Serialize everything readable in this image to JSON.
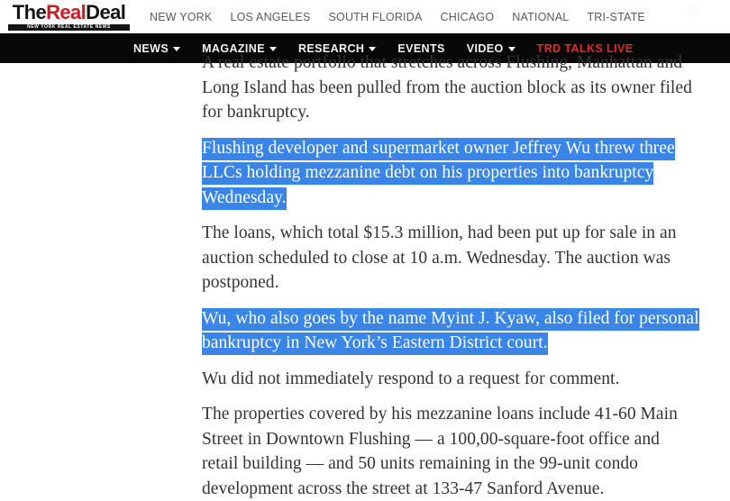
{
  "site": {
    "logo": {
      "part1": "The",
      "part2": "Real",
      "part3": "Deal",
      "tagline": "NEW YORK REAL ESTATE NEWS"
    },
    "brand_colors": {
      "red": "#cf181f",
      "black": "#141414",
      "nav_bar": "#080808",
      "selection_blue": "#3a86e8"
    },
    "top_nav": [
      {
        "label": "NEW YORK"
      },
      {
        "label": "LOS ANGELES"
      },
      {
        "label": "SOUTH FLORIDA"
      },
      {
        "label": "CHICAGO"
      },
      {
        "label": "NATIONAL"
      },
      {
        "label": "TRI-STATE"
      }
    ],
    "search_icon": "search-icon",
    "main_nav": [
      {
        "label": "NEWS",
        "has_dropdown": true,
        "accent": false
      },
      {
        "label": "MAGAZINE",
        "has_dropdown": true,
        "accent": false
      },
      {
        "label": "RESEARCH",
        "has_dropdown": true,
        "accent": false
      },
      {
        "label": "EVENTS",
        "has_dropdown": false,
        "accent": false
      },
      {
        "label": "VIDEO",
        "has_dropdown": true,
        "accent": false
      },
      {
        "label": "TRD TALKS LIVE",
        "has_dropdown": false,
        "accent": true
      }
    ]
  },
  "article": {
    "paragraphs": [
      {
        "clipped": true,
        "segments": [
          {
            "text": "A real estate portfolio that stretches across Flushing, Manhattan and Long Island has been pulled from the auction block as its owner filed for bankruptcy.",
            "highlighted": false
          }
        ]
      },
      {
        "clipped": false,
        "segments": [
          {
            "text": "Flushing developer and supermarket owner Jeffrey Wu threw three LLCs holding mezzanine debt on his properties into bankruptcy Wednesday.",
            "highlighted": true
          }
        ]
      },
      {
        "clipped": false,
        "segments": [
          {
            "text": "The loans, which total $15.3 million, had been put up for sale in an auction scheduled to close at 10 a.m. Wednesday. The auction was postponed.",
            "highlighted": false
          }
        ]
      },
      {
        "clipped": false,
        "segments": [
          {
            "text": " Wu, who also goes by the name Myint J. Kyaw, also filed for personal bankruptcy in New York’s Eastern District court.",
            "highlighted": true
          }
        ]
      },
      {
        "clipped": false,
        "segments": [
          {
            "text": "Wu did not immediately respond to a request for comment.",
            "highlighted": false
          }
        ]
      },
      {
        "clipped": false,
        "segments": [
          {
            "text": "The properties covered by his mezzanine loans include 41-60 Main Street in Downtown Flushing — a 100,00-square-foot office and retail building — and 50 units remaining in the 99-unit condo development across the street at 133-47 Sanford Avenue.",
            "highlighted": false
          }
        ]
      }
    ]
  }
}
